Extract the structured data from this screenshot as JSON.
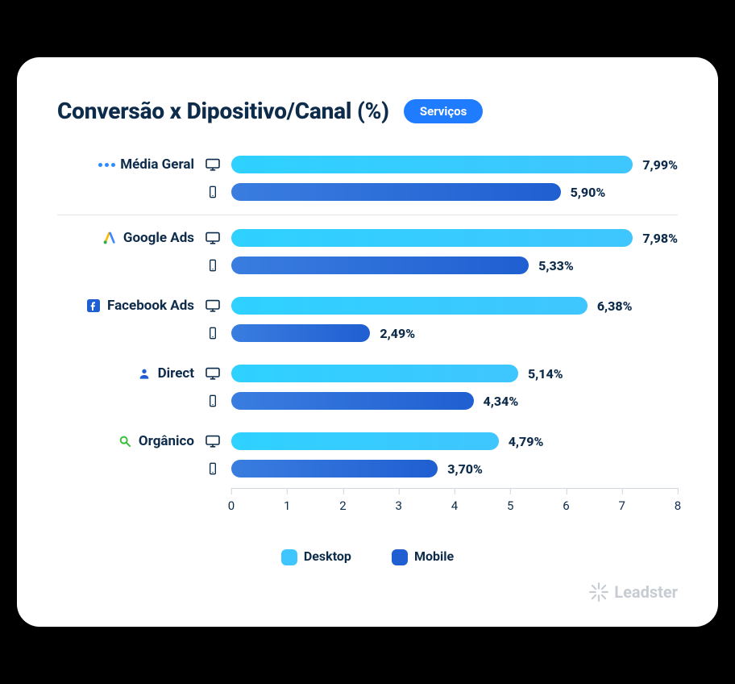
{
  "title": "Conversão x Dipositivo/Canal (%)",
  "pill": "Serviços",
  "legend": {
    "desktop": "Desktop",
    "mobile": "Mobile"
  },
  "brand": "Leadster",
  "axis": {
    "min": 0,
    "max": 8,
    "ticks": [
      "0",
      "1",
      "2",
      "3",
      "4",
      "5",
      "6",
      "7",
      "8"
    ]
  },
  "chart_data": {
    "type": "bar",
    "orientation": "horizontal",
    "title": "Conversão x Dipositivo/Canal (%)",
    "xlabel": "",
    "ylabel": "",
    "xlim": [
      0,
      8
    ],
    "categories": [
      "Média Geral",
      "Google Ads",
      "Facebook Ads",
      "Direct",
      "Orgânico"
    ],
    "series": [
      {
        "name": "Desktop",
        "values": [
          7.99,
          7.98,
          6.38,
          5.14,
          4.79
        ],
        "labels": [
          "7,99%",
          "7,98%",
          "6,38%",
          "5,14%",
          "4,79%"
        ],
        "color": "#3fc6ff"
      },
      {
        "name": "Mobile",
        "values": [
          5.9,
          5.33,
          2.49,
          4.34,
          3.7
        ],
        "labels": [
          "5,90%",
          "5,33%",
          "2,49%",
          "4,34%",
          "3,70%"
        ],
        "color": "#1f5fd1"
      }
    ],
    "divider_after_index": 0
  }
}
